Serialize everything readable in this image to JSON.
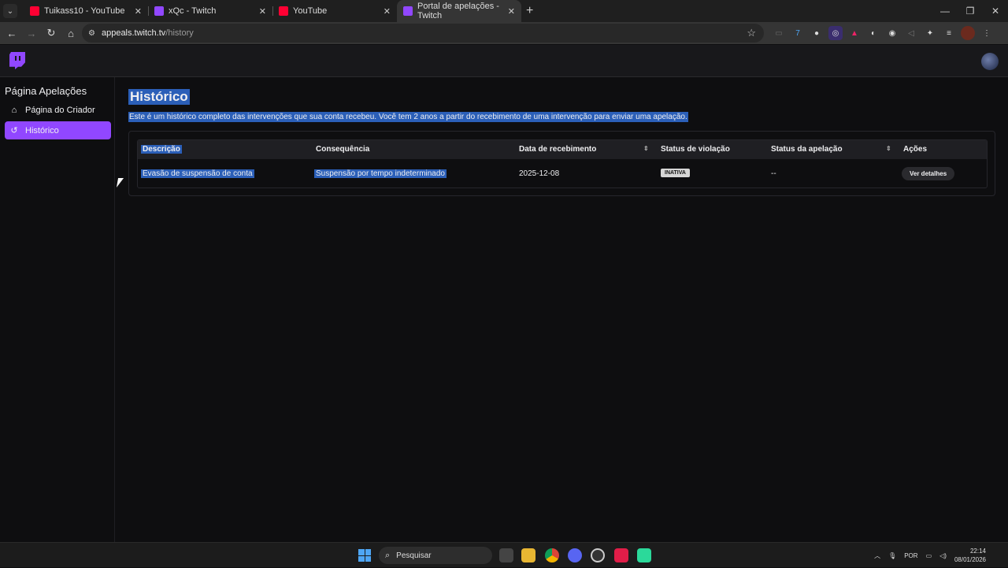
{
  "browser": {
    "tabs": [
      {
        "title": "Tuikass10 - YouTube",
        "favicon": "youtube-icon",
        "active": false
      },
      {
        "title": "xQc - Twitch",
        "favicon": "twitch-icon",
        "active": false
      },
      {
        "title": "YouTube",
        "favicon": "youtube-icon",
        "active": false
      },
      {
        "title": "Portal de apelações - Twitch",
        "favicon": "twitch-icon",
        "active": true
      }
    ],
    "url_host": "appeals.twitch.tv",
    "url_path": "/history"
  },
  "sidebar": {
    "title": "Página Apelações",
    "items": [
      {
        "label": "Página do Criador",
        "icon": "home-icon"
      },
      {
        "label": "Histórico",
        "icon": "history-icon"
      }
    ]
  },
  "main": {
    "title": "Histórico",
    "description": "Este é um histórico completo das intervenções que sua conta recebeu. Você tem 2 anos a partir do recebimento de uma intervenção para enviar uma apelação.",
    "table": {
      "headers": [
        "Descrição",
        "Consequência",
        "Data de recebimento",
        "Status de violação",
        "Status da apelação",
        "Ações"
      ],
      "rows": [
        {
          "description": "Evasão de suspensão de conta",
          "consequence": "Suspensão por tempo indeterminado",
          "date": "2025-12-08",
          "violation_status": "INATIVA",
          "appeal_status": "--",
          "action": "Ver detalhes"
        }
      ]
    }
  },
  "taskbar": {
    "search_placeholder": "Pesquisar",
    "language": "POR",
    "time": "22:14",
    "date": "08/01/2026"
  },
  "colors": {
    "accent": "#9147ff",
    "background": "#0e0e10",
    "selection": "#2b5fb8"
  }
}
